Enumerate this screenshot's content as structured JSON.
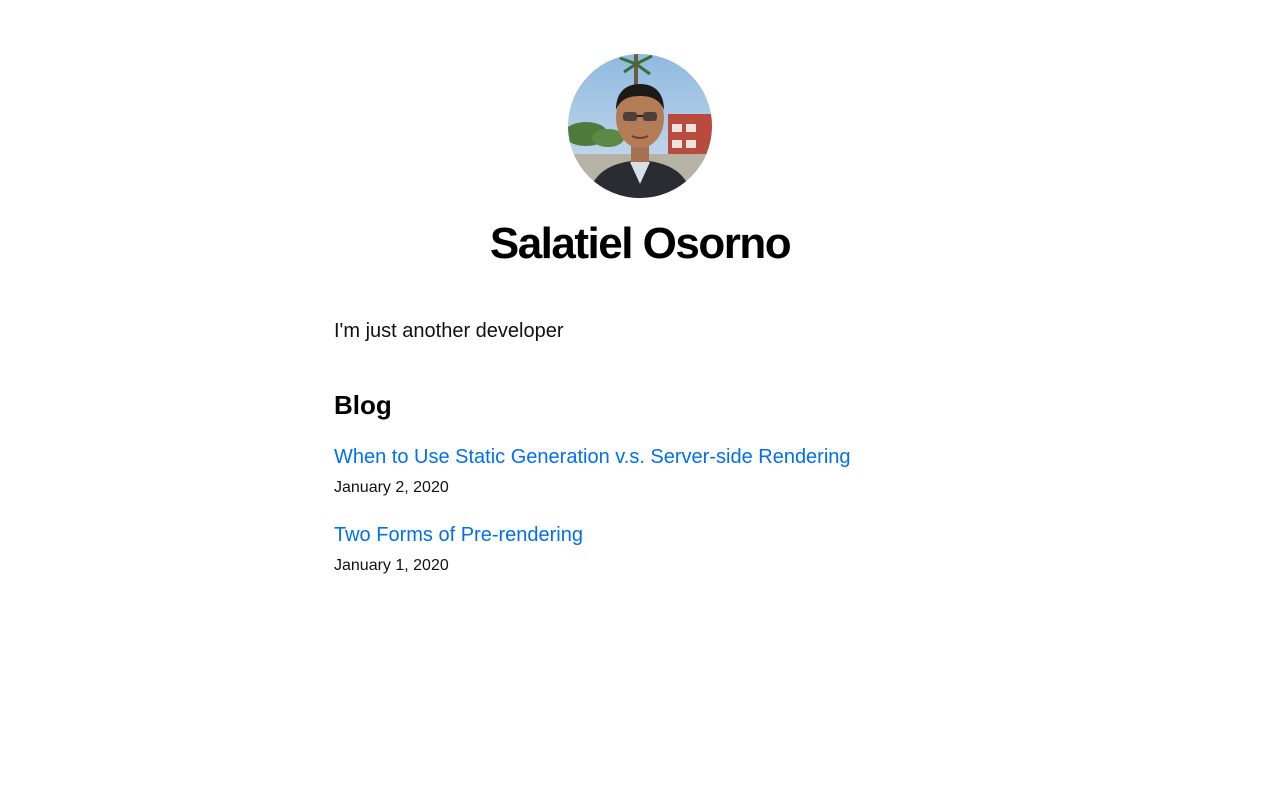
{
  "profile": {
    "name": "Salatiel Osorno",
    "avatar_alt": "Salatiel Osorno"
  },
  "intro": {
    "text": "I'm just another developer"
  },
  "blog": {
    "heading": "Blog",
    "posts": [
      {
        "title": "When to Use Static Generation v.s. Server-side Rendering",
        "date": "January 2, 2020"
      },
      {
        "title": "Two Forms of Pre-rendering",
        "date": "January 1, 2020"
      }
    ]
  },
  "colors": {
    "link": "#0070f3",
    "text": "#111111",
    "background": "#ffffff"
  }
}
